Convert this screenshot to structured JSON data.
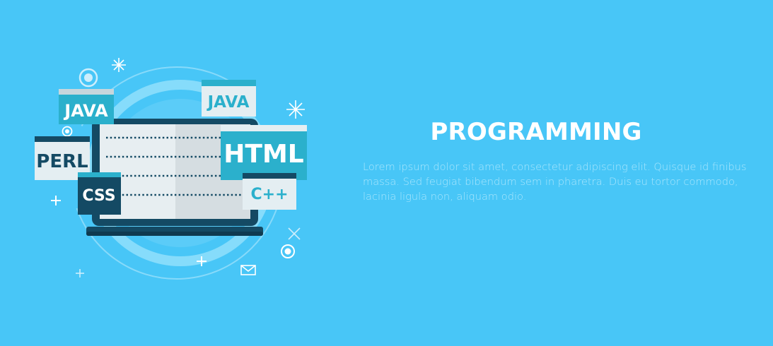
{
  "banner": {
    "title": "PROGRAMMING",
    "description": "Lorem ipsum dolor sit amet, consectetur adipiscing elit. Quisque id finibus massa. Sed feugiat bibendum sem in pharetra. Duis eu tortor commodo, lacinia ligula non, aliquam odio."
  },
  "cards": {
    "java_left": "JAVA",
    "java_top": "JAVA",
    "perl": "PERL",
    "css": "CSS",
    "html": "HTML",
    "cpp": "C++"
  },
  "colors": {
    "background": "#48c6f7",
    "dark_navy": "#144a64",
    "teal": "#2bb0cc",
    "card_light": "#e4eef2",
    "text_light": "#a9e6fd"
  }
}
